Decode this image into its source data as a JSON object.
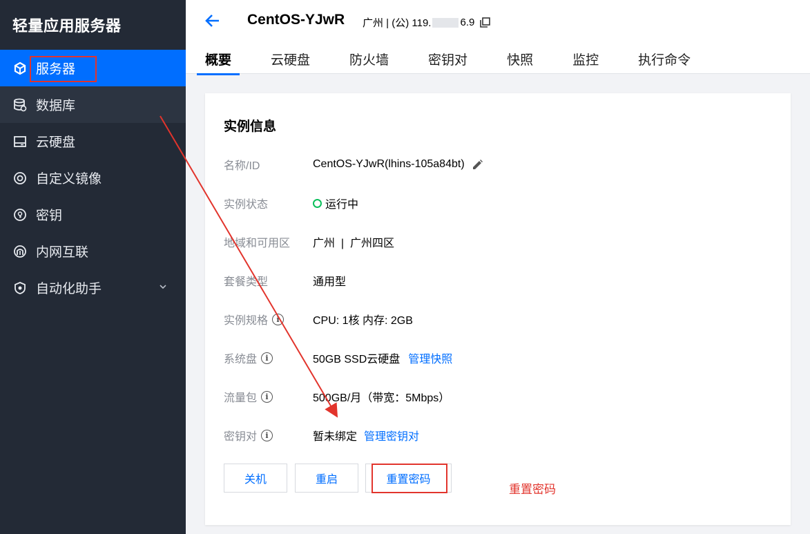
{
  "sidebar": {
    "title": "轻量应用服务器",
    "items": [
      {
        "label": "服务器",
        "icon": "server-icon"
      },
      {
        "label": "数据库",
        "icon": "database-icon"
      },
      {
        "label": "云硬盘",
        "icon": "disk-icon"
      },
      {
        "label": "自定义镜像",
        "icon": "image-icon"
      },
      {
        "label": "密钥",
        "icon": "key-icon"
      },
      {
        "label": "内网互联",
        "icon": "network-icon"
      },
      {
        "label": "自动化助手",
        "icon": "automation-icon"
      }
    ]
  },
  "header": {
    "instance_name": "CentOS-YJwR",
    "ip_prefix": "广州 | (公) 119.",
    "ip_suffix": "6.9",
    "tabs": [
      "概要",
      "云硬盘",
      "防火墙",
      "密钥对",
      "快照",
      "监控",
      "执行命令"
    ]
  },
  "card": {
    "title": "实例信息",
    "rows": {
      "name": {
        "label": "名称/ID",
        "value": "CentOS-YJwR(lhins-105a84bt)"
      },
      "status": {
        "label": "实例状态",
        "value": "运行中"
      },
      "region": {
        "label": "地域和可用区",
        "value": "广州  |  广州四区"
      },
      "plan": {
        "label": "套餐类型",
        "value": "通用型"
      },
      "spec": {
        "label": "实例规格",
        "value": "CPU: 1核 内存: 2GB"
      },
      "disk": {
        "label": "系统盘",
        "value": "50GB SSD云硬盘",
        "link": "管理快照"
      },
      "traffic": {
        "label": "流量包",
        "value": "500GB/月（带宽：5Mbps）"
      },
      "keypair": {
        "label": "密钥对",
        "value": "暂未绑定",
        "link": "管理密钥对"
      }
    },
    "buttons": {
      "shutdown": "关机",
      "restart": "重启",
      "reset_password": "重置密码"
    }
  },
  "annotation": {
    "text": "重置密码"
  },
  "colors": {
    "accent": "#006eff",
    "sidebar_bg": "#232a36",
    "annotation_red": "#e2342c",
    "status_green": "#0abf5b"
  }
}
